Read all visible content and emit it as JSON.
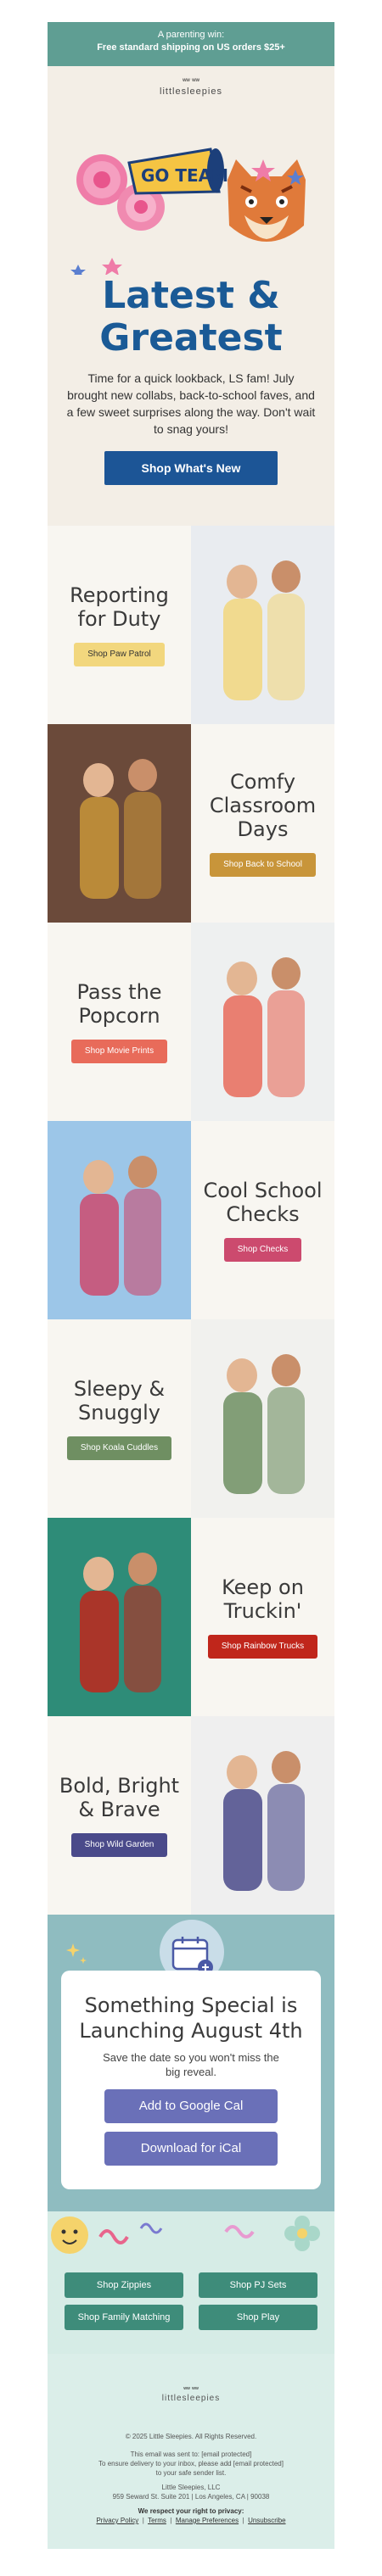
{
  "banner": {
    "line1": "A parenting win:",
    "line2": "Free standard shipping on US orders $25+"
  },
  "brand": {
    "name": "littlesleepies",
    "eyes": "ʷʷ ʷʷ"
  },
  "hero": {
    "art_text": "GO TEAM",
    "headline_1": "Latest &",
    "headline_2": "Greatest",
    "body": "Time for a quick lookback, LS fam! July brought new collabs, back-to-school faves, and a few sweet surprises along the way. Don't wait to snag yours!",
    "cta": "Shop What's New"
  },
  "rows": [
    {
      "title": "Reporting for Duty",
      "cta": "Shop Paw Patrol",
      "cta_color": "#f2d77e",
      "cta_text": "#333333",
      "image_side": "right",
      "photo": "paw-patrol-photo",
      "bg": "#e9ecf0"
    },
    {
      "title": "Comfy Classroom Days",
      "cta": "Shop Back to School",
      "cta_color": "#c8953a",
      "cta_text": "#ffffff",
      "image_side": "left",
      "photo": "back-to-school-photo",
      "bg": "#6b4a3a"
    },
    {
      "title": "Pass the Popcorn",
      "cta": "Shop Movie Prints",
      "cta_color": "#e86b5a",
      "cta_text": "#ffffff",
      "image_side": "right",
      "photo": "movie-prints-photo",
      "bg": "#eef0f0"
    },
    {
      "title": "Cool School Checks",
      "cta": "Shop Checks",
      "cta_color": "#cc4a6e",
      "cta_text": "#ffffff",
      "image_side": "left",
      "photo": "checks-photo",
      "bg": "#9cc6e8"
    },
    {
      "title": "Sleepy & Snuggly",
      "cta": "Shop Koala Cuddles",
      "cta_color": "#6f8f62",
      "cta_text": "#ffffff",
      "image_side": "right",
      "photo": "koala-cuddles-photo",
      "bg": "#f1f1ee"
    },
    {
      "title": "Keep on Truckin'",
      "cta": "Shop Rainbow Trucks",
      "cta_color": "#c0261b",
      "cta_text": "#ffffff",
      "image_side": "left",
      "photo": "rainbow-trucks-photo",
      "bg": "#2e8c78"
    },
    {
      "title": "Bold, Bright & Brave",
      "cta": "Shop Wild Garden",
      "cta_color": "#4a4a8a",
      "cta_text": "#ffffff",
      "image_side": "right",
      "photo": "wild-garden-photo",
      "bg": "#efefef"
    }
  ],
  "special": {
    "title": "Something Special is Launching August 4th",
    "body": "Save the date so you won't miss the big reveal.",
    "google": "Add to Google Cal",
    "ical": "Download for iCal"
  },
  "footer_links": [
    "Shop Zippies",
    "Shop PJ Sets",
    "Shop Family Matching",
    "Shop Play"
  ],
  "footer": {
    "copyright": "© 2025 Little Sleepies. All Rights Reserved.",
    "sent_to": "This email was sent to: [email protected]",
    "delivery": "To ensure delivery to your inbox, please add [email protected] to your safe sender list.",
    "company": "Little Sleepies, LLC",
    "address": "959 Seward St. Suite 201  |  Los Angeles, CA  |  90038",
    "privacy_heading": "We respect your right to privacy:",
    "links": [
      "Privacy Policy",
      "Terms",
      "Manage Preferences",
      "Unsubscribe"
    ]
  }
}
